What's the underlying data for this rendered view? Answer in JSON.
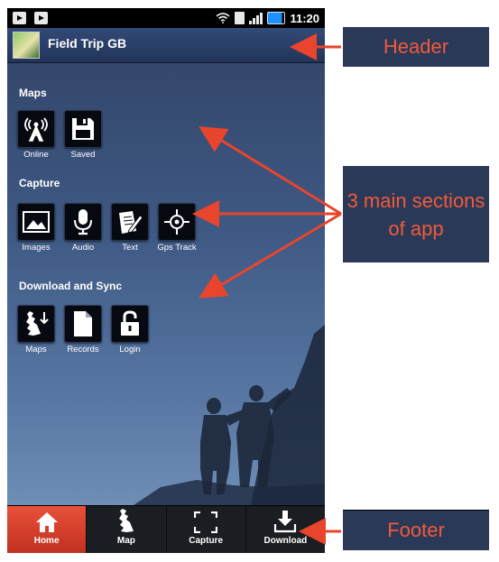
{
  "status_bar": {
    "time": "11:20"
  },
  "app": {
    "title": "Field Trip GB"
  },
  "sections": [
    {
      "title": "Maps",
      "items": [
        {
          "label": "Online",
          "icon": "antenna-icon"
        },
        {
          "label": "Saved",
          "icon": "floppy-disk-icon"
        }
      ]
    },
    {
      "title": "Capture",
      "items": [
        {
          "label": "Images",
          "icon": "image-icon"
        },
        {
          "label": "Audio",
          "icon": "microphone-icon"
        },
        {
          "label": "Text",
          "icon": "pencil-note-icon"
        },
        {
          "label": "Gps Track",
          "icon": "crosshair-icon"
        }
      ]
    },
    {
      "title": "Download and Sync",
      "items": [
        {
          "label": "Maps",
          "icon": "gb-map-download-icon"
        },
        {
          "label": "Records",
          "icon": "document-icon"
        },
        {
          "label": "Login",
          "icon": "unlock-icon"
        }
      ]
    }
  ],
  "footer": {
    "tabs": [
      {
        "label": "Home",
        "icon": "home-icon",
        "active": true
      },
      {
        "label": "Map",
        "icon": "gb-map-icon",
        "active": false
      },
      {
        "label": "Capture",
        "icon": "capture-frame-icon",
        "active": false
      },
      {
        "label": "Download",
        "icon": "download-icon",
        "active": false
      }
    ]
  },
  "callouts": {
    "header": "Header",
    "sections": "3 main sections of app",
    "footer": "Footer"
  },
  "colors": {
    "callout_bg": "#2a3958",
    "callout_text": "#f05a3a",
    "arrow": "#e8452c",
    "active_tab": "#d8402b"
  }
}
